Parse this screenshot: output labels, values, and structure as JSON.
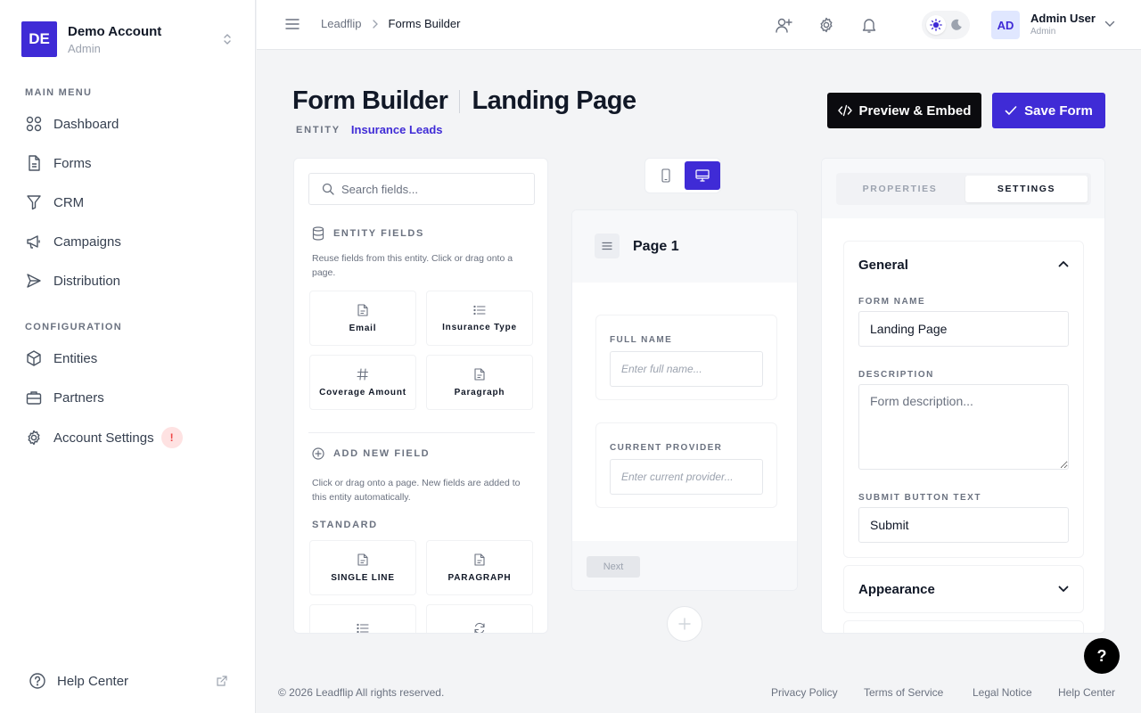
{
  "account": {
    "initials": "DE",
    "name": "Demo Account",
    "role": "Admin"
  },
  "sidebar": {
    "main_menu_label": "MAIN MENU",
    "main_items": [
      {
        "label": "Dashboard",
        "icon": "grid-icon"
      },
      {
        "label": "Forms",
        "icon": "document-icon"
      },
      {
        "label": "CRM",
        "icon": "filter-icon"
      },
      {
        "label": "Campaigns",
        "icon": "megaphone-icon"
      },
      {
        "label": "Distribution",
        "icon": "send-icon"
      }
    ],
    "config_label": "CONFIGURATION",
    "config_items": [
      {
        "label": "Entities",
        "icon": "cube-icon"
      },
      {
        "label": "Partners",
        "icon": "briefcase-icon"
      },
      {
        "label": "Account Settings",
        "icon": "gear-icon",
        "badge": "!"
      }
    ],
    "help_label": "Help Center"
  },
  "topbar": {
    "breadcrumb": [
      "Leadflip",
      "Forms Builder"
    ],
    "user": {
      "initials": "AD",
      "name": "Admin User",
      "role": "Admin"
    }
  },
  "header": {
    "title": "Form Builder",
    "subtitle": "Landing Page",
    "entity_label": "ENTITY",
    "entity_value": "Insurance Leads",
    "preview_button": "Preview & Embed",
    "save_button": "Save Form"
  },
  "left_panel": {
    "search_placeholder": "Search fields...",
    "entity_fields_title": "ENTITY FIELDS",
    "entity_fields_desc": "Reuse fields from this entity. Click or drag onto a page.",
    "entity_fields": [
      "Email",
      "Insurance Type",
      "Coverage Amount",
      "Paragraph"
    ],
    "add_new_title": "ADD NEW FIELD",
    "add_new_desc": "Click or drag onto a page. New fields are added to this entity automatically.",
    "standard_label": "STANDARD",
    "standard_fields": [
      "SINGLE LINE",
      "PARAGRAPH"
    ]
  },
  "canvas": {
    "page_title": "Page 1",
    "fields": [
      {
        "label": "FULL NAME",
        "placeholder": "Enter full name..."
      },
      {
        "label": "CURRENT PROVIDER",
        "placeholder": "Enter current provider..."
      }
    ],
    "next_button": "Next"
  },
  "right_panel": {
    "tabs": [
      "PROPERTIES",
      "SETTINGS"
    ],
    "active_tab": "SETTINGS",
    "general_title": "General",
    "form_name_label": "FORM NAME",
    "form_name_value": "Landing Page",
    "description_label": "DESCRIPTION",
    "description_placeholder": "Form description...",
    "submit_text_label": "SUBMIT BUTTON TEXT",
    "submit_text_value": "Submit",
    "appearance_title": "Appearance"
  },
  "footer": {
    "copyright": "© 2026 Leadflip All rights reserved.",
    "links": [
      "Privacy Policy",
      "Terms of Service",
      "Legal Notice",
      "Help Center"
    ]
  },
  "help_fab": "?",
  "colors": {
    "primary": "#3f2bd6",
    "dark": "#0b0b0f",
    "alert": "#ef4444"
  }
}
